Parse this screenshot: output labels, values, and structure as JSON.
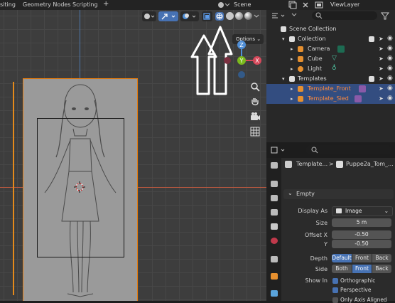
{
  "topbar": {
    "tabs": [
      "siting",
      "Geometry Nodes",
      "Scripting"
    ],
    "add_tab": "+",
    "scene_label": "Scene",
    "viewlayer_label": "ViewLayer"
  },
  "viewport": {
    "options_label": "Options",
    "gizmo": {
      "z": "Z",
      "y": "Y",
      "x": "X"
    }
  },
  "outliner": {
    "rows": [
      {
        "label": "Scene Collection"
      },
      {
        "label": "Collection"
      },
      {
        "label": "Camera"
      },
      {
        "label": "Cube"
      },
      {
        "label": "Light"
      },
      {
        "label": "Templates"
      },
      {
        "label": "Template_Front"
      },
      {
        "label": "Template_Sied"
      }
    ]
  },
  "properties": {
    "breadcrumb_object": "Template...",
    "breadcrumb_sep": ">",
    "breadcrumb_data": "Puppe2a_Tom_...",
    "section": "Empty",
    "display_as_label": "Display As",
    "display_as_value": "Image",
    "size_label": "Size",
    "size_value": "5 m",
    "offset_x_label": "Offset X",
    "offset_x_value": "-0.50",
    "offset_y_label": "Y",
    "offset_y_value": "-0.50",
    "depth_label": "Depth",
    "depth_options": [
      "Default",
      "Front",
      "Back"
    ],
    "side_label": "Side",
    "side_options": [
      "Both",
      "Front",
      "Back"
    ],
    "show_in_label": "Show In",
    "orthographic_label": "Orthographic",
    "perspective_label": "Perspective",
    "only_axis_label": "Only Axis Aligned"
  },
  "colors": {
    "accent": "#4772b3",
    "selected_text": "#ff8a3d",
    "active_outline": "#e87d0d"
  }
}
